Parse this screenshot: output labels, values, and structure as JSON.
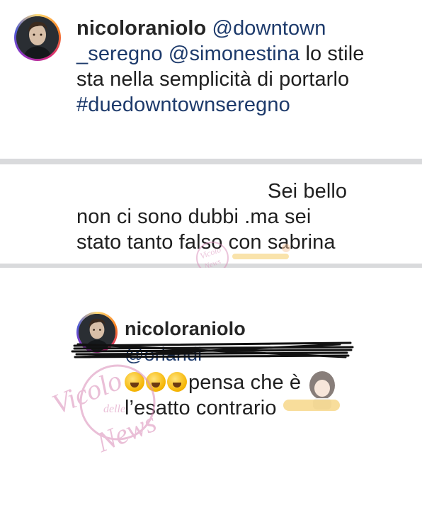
{
  "caption": {
    "username": "nicoloraniolo",
    "mention1_part1": "@downtown",
    "mention1_part2": "_seregno",
    "mention2": "@simonestina",
    "text_part1": "lo stile",
    "text_part2": "sta nella semplicità di portarlo",
    "hashtag": "#duedowntownseregno"
  },
  "comment": {
    "line1": "Sei bello",
    "line2": "non ci sono dubbi .ma sei",
    "line3": "stato tanto falso con sabrina"
  },
  "reply": {
    "username": "nicoloraniolo",
    "mention_obscured": "@orlandi",
    "text_part1": "pensa che è",
    "text_part2": "l’esatto contrario"
  },
  "watermark": {
    "line1": "Vicolo",
    "line2": "delle",
    "line3": "News"
  },
  "colors": {
    "link": "#1d3a6b",
    "text": "#262626",
    "watermark": "#d98cb8"
  },
  "icons": {
    "emoji": "rolling-on-floor-laughing-emoji"
  }
}
